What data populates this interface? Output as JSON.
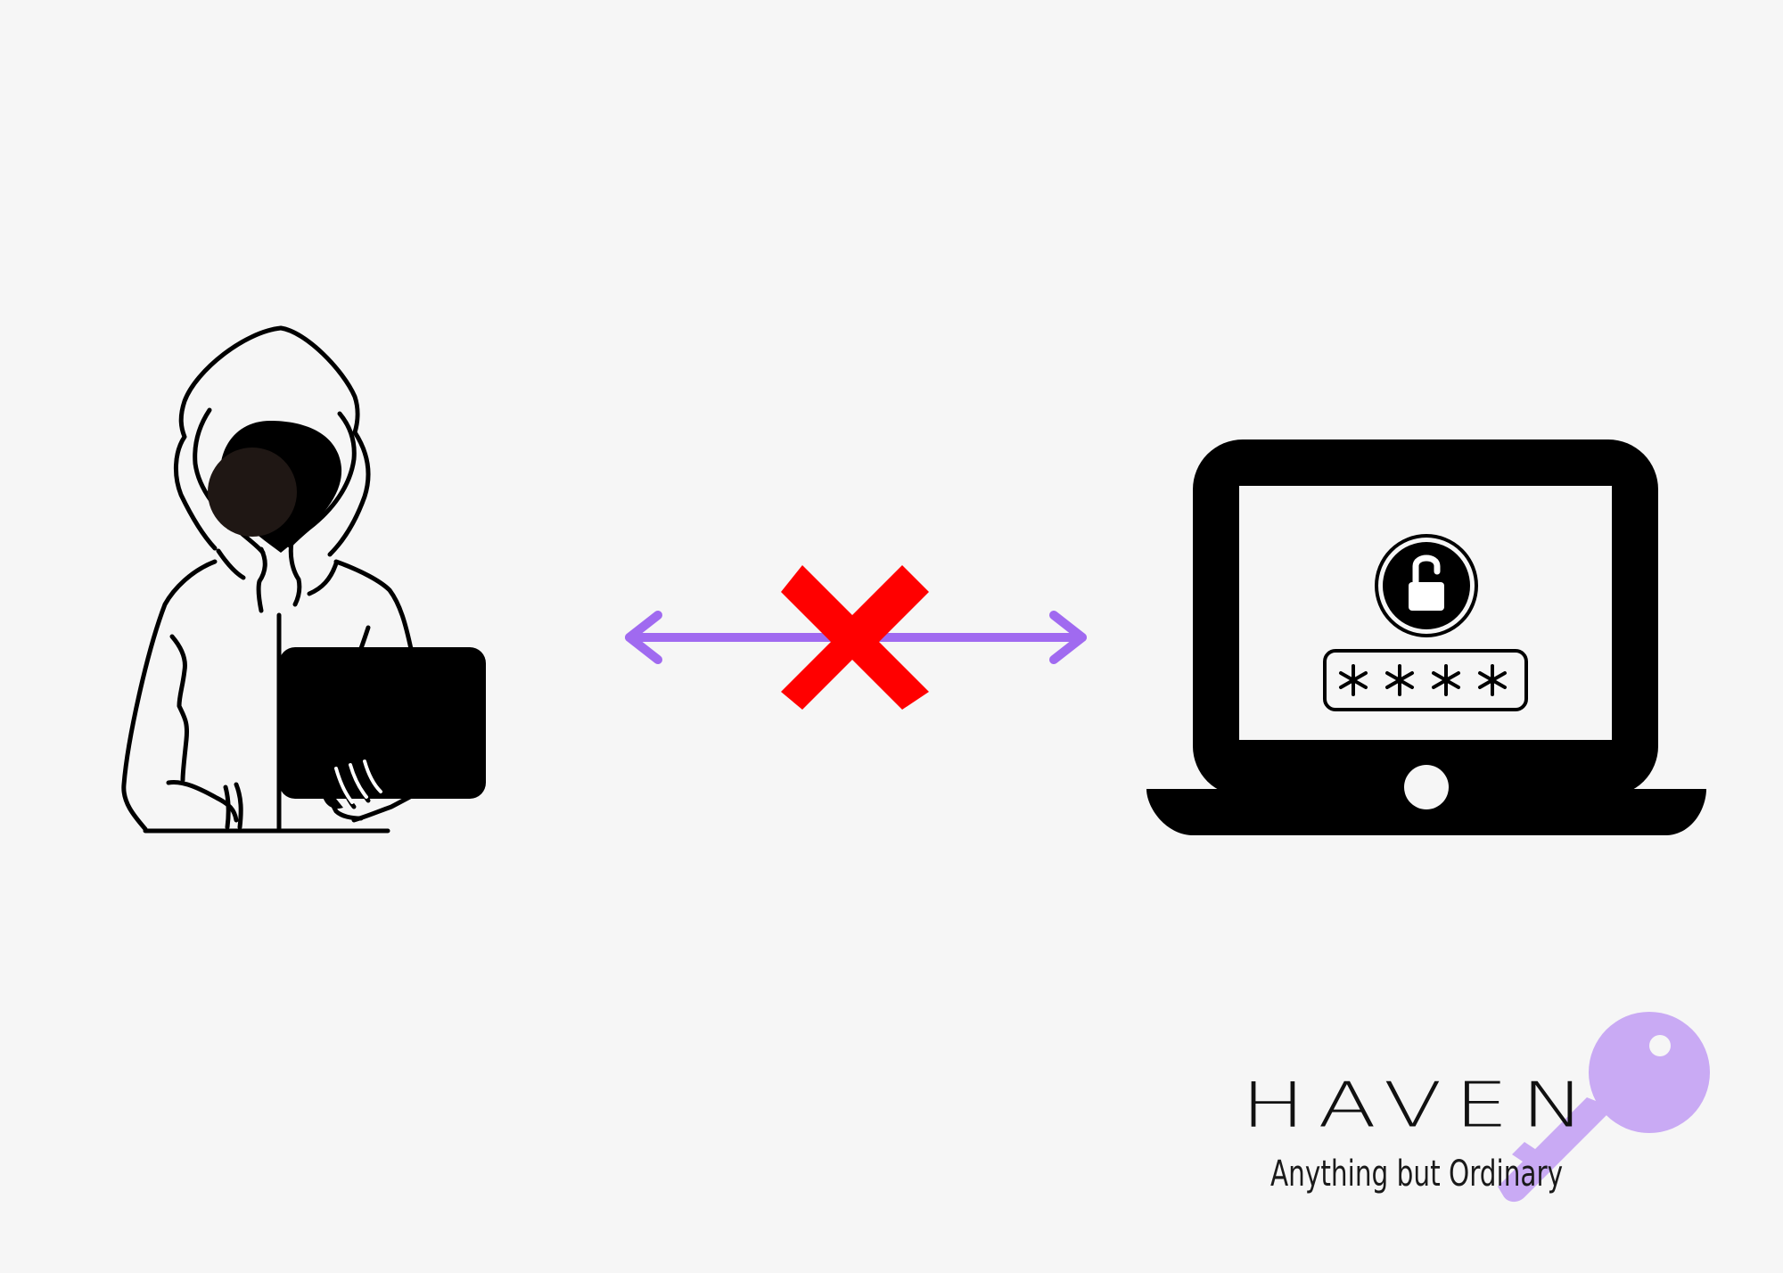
{
  "scene": {
    "background": "#f6f6f6",
    "hacker": {
      "icon": "hooded-hacker-icon",
      "holding": "laptop"
    },
    "connection": {
      "icon": "bidirectional-arrow-icon",
      "arrow_color": "#a06af0",
      "status": "blocked",
      "block_icon": "red-x-icon",
      "block_color": "#ff0000"
    },
    "laptop": {
      "icon": "locked-laptop-icon",
      "lock_icon": "padlock-icon",
      "password_mask": "****"
    }
  },
  "brand": {
    "name": "HAVEN",
    "tagline": "Anything but Ordinary",
    "logo_icon": "key-icon",
    "key_color": "#c9aaf4"
  }
}
